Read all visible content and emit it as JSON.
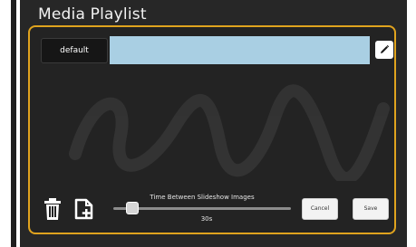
{
  "dialog": {
    "title": "Media Playlist"
  },
  "playlist": {
    "preset_label": "default",
    "name_value": "",
    "name_placeholder": ""
  },
  "slideshow": {
    "label": "Time Between Slideshow Images",
    "value_text": "30s",
    "value_fraction": 0.1
  },
  "actions": {
    "cancel_label": "Cancel",
    "save_label": "Save"
  },
  "icons": {
    "edit": "pencil-icon",
    "delete": "trash-icon",
    "add": "add-file-icon"
  },
  "colors": {
    "accent_border": "#e0a31e",
    "input_fill": "#a9cfe3",
    "window_bg": "#272727"
  }
}
